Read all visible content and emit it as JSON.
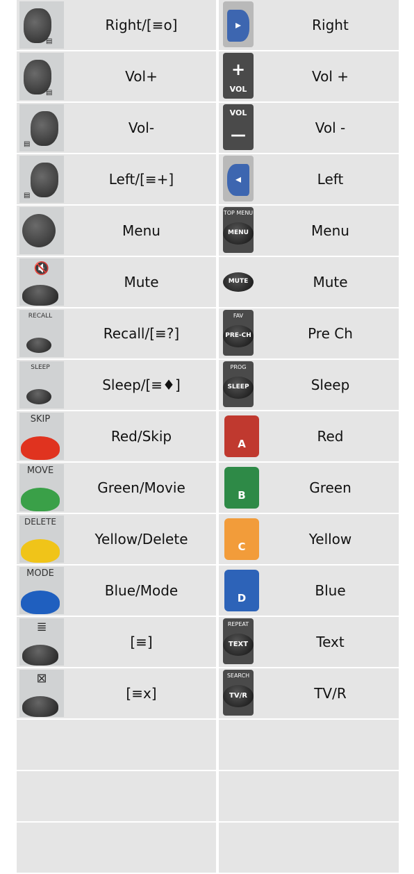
{
  "rows": [
    {
      "left": {
        "label": "Right/[≡o]",
        "icon": "rocker-right-icon",
        "icon_caption": ""
      },
      "right": {
        "label": "Right",
        "icon": "blue-right-arrow-icon",
        "btn_text": "▸"
      }
    },
    {
      "left": {
        "label": "Vol+",
        "icon": "rocker-right-icon",
        "icon_caption": ""
      },
      "right": {
        "label": "Vol +",
        "icon": "vol-plus-icon",
        "btn_text": "+",
        "btn_sub": "VOL"
      }
    },
    {
      "left": {
        "label": "Vol-",
        "icon": "rocker-left-icon",
        "icon_caption": ""
      },
      "right": {
        "label": "Vol -",
        "icon": "vol-minus-icon",
        "btn_text": "—",
        "btn_sub": "VOL"
      }
    },
    {
      "left": {
        "label": "Left/[≡+]",
        "icon": "rocker-left-icon",
        "icon_caption": ""
      },
      "right": {
        "label": "Left",
        "icon": "blue-left-arrow-icon",
        "btn_text": "◂"
      }
    },
    {
      "left": {
        "label": "Menu",
        "icon": "round-button-icon",
        "icon_caption": ""
      },
      "right": {
        "label": "Menu",
        "icon": "menu-button-icon",
        "btn_caption": "TOP MENU",
        "btn_text": "MENU"
      }
    },
    {
      "left": {
        "label": "Mute",
        "icon": "mute-icon",
        "icon_caption": "🕨̸"
      },
      "right": {
        "label": "Mute",
        "icon": "mute-button-icon",
        "btn_text": "MUTE"
      }
    },
    {
      "left": {
        "label": "Recall/[≡?]",
        "icon": "recall-icon",
        "icon_caption": "RECALL"
      },
      "right": {
        "label": "Pre Ch",
        "icon": "prech-button-icon",
        "btn_caption": "FAV",
        "btn_text": "PRE-CH"
      }
    },
    {
      "left": {
        "label": "Sleep/[≡♦]",
        "icon": "sleep-icon",
        "icon_caption": "SLEEP"
      },
      "right": {
        "label": "Sleep",
        "icon": "sleep-button-icon",
        "btn_caption": "PROG",
        "btn_text": "SLEEP"
      }
    },
    {
      "left": {
        "label": "Red/Skip",
        "icon": "red-skip-icon",
        "icon_caption": "SKIP",
        "color": "#e0331f"
      },
      "right": {
        "label": "Red",
        "icon": "red-a-button-icon",
        "btn_text": "A",
        "color": "#c0392f"
      }
    },
    {
      "left": {
        "label": "Green/Movie",
        "icon": "green-move-icon",
        "icon_caption": "MOVE",
        "color": "#3aa048"
      },
      "right": {
        "label": "Green",
        "icon": "green-b-button-icon",
        "btn_text": "B",
        "color": "#2e8a47"
      }
    },
    {
      "left": {
        "label": "Yellow/Delete",
        "icon": "yellow-delete-icon",
        "icon_caption": "DELETE",
        "color": "#f0c419"
      },
      "right": {
        "label": "Yellow",
        "icon": "yellow-c-button-icon",
        "btn_text": "C",
        "color": "#f29c3a"
      }
    },
    {
      "left": {
        "label": "Blue/Mode",
        "icon": "blue-mode-icon",
        "icon_caption": "MODE",
        "color": "#1f5fbf"
      },
      "right": {
        "label": "Blue",
        "icon": "blue-d-button-icon",
        "btn_text": "D",
        "color": "#2d63b8"
      }
    },
    {
      "left": {
        "label": "[≡]",
        "icon": "text-icon",
        "icon_caption": "≣"
      },
      "right": {
        "label": "Text",
        "icon": "text-button-icon",
        "btn_caption": "REPEAT",
        "btn_text": "TEXT"
      }
    },
    {
      "left": {
        "label": "[≡x]",
        "icon": "text-x-icon",
        "icon_caption": "⊠"
      },
      "right": {
        "label": "TV/R",
        "icon": "tvr-button-icon",
        "btn_caption": "SEARCH",
        "btn_text": "TV/R"
      }
    },
    {
      "left": {
        "label": ""
      },
      "right": {
        "label": ""
      }
    },
    {
      "left": {
        "label": ""
      },
      "right": {
        "label": ""
      }
    },
    {
      "left": {
        "label": ""
      },
      "right": {
        "label": ""
      }
    }
  ]
}
